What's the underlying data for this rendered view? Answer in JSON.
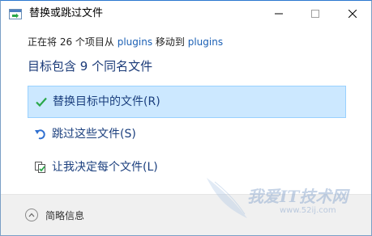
{
  "window": {
    "title": "替换或跳过文件",
    "minimize_label": "—",
    "maximize_label": "☐",
    "close_label": "✕"
  },
  "status": {
    "prefix": "正在将 26 个项目从 ",
    "source": "plugins",
    "middle": " 移动到 ",
    "destination": "plugins"
  },
  "heading": "目标包含 9 个同名文件",
  "options": [
    {
      "label": "替换目标中的文件(R)",
      "icon": "check-icon",
      "selected": true
    },
    {
      "label": "跳过这些文件(S)",
      "icon": "skip-icon",
      "selected": false
    },
    {
      "label": "让我决定每个文件(L)",
      "icon": "decide-icon",
      "selected": false
    }
  ],
  "footer": {
    "details_label": "简略信息"
  },
  "watermark": {
    "text": "我爱IT技术网",
    "url": "www.52ij.com"
  },
  "colors": {
    "accent": "#1a5fb4",
    "selected_bg": "#cce8ff",
    "selected_border": "#99d1ff",
    "check_green": "#2ba84a",
    "footer_bg": "#f0f0f0"
  }
}
